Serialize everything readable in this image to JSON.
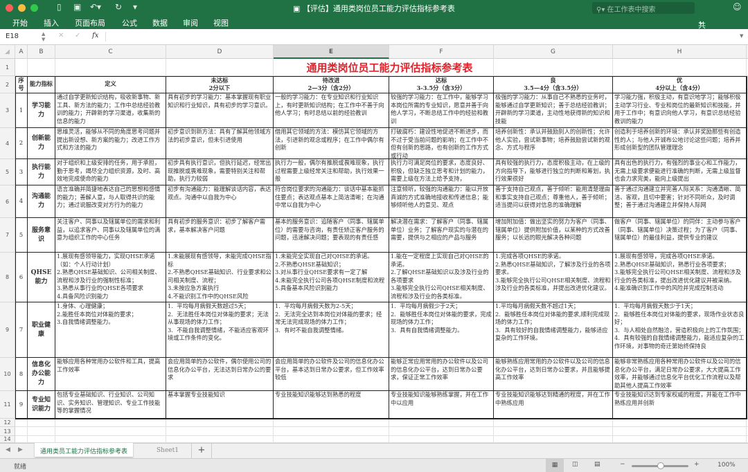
{
  "window": {
    "title": "【评估】通用类岗位员工能力评估指标参考表",
    "search_placeholder": "在工作表中搜索"
  },
  "ribbon": {
    "tabs": [
      "开始",
      "插入",
      "页面布局",
      "公式",
      "数据",
      "审阅",
      "视图"
    ],
    "share": "共享"
  },
  "formula_bar": {
    "cell_ref": "E18",
    "fx": "fx",
    "value": ""
  },
  "columns": [
    "A",
    "B",
    "C",
    "D",
    "E",
    "F",
    "G",
    "H"
  ],
  "row_numbers": [
    "1",
    "2",
    "3",
    "4",
    "5",
    "6",
    "7",
    "8",
    "9",
    "10",
    "11",
    "12",
    "13",
    "14"
  ],
  "sheet": {
    "title": "通用类岗位员工能力评估指标参考表",
    "headers": {
      "no": "序号",
      "name": "能力指标",
      "def": "定义",
      "levels": [
        {
          "label": "未达标",
          "range": "2分以下"
        },
        {
          "label": "待改进",
          "range": "2—3分（含2分）"
        },
        {
          "label": "达标",
          "range": "3-3.5分（含3分）"
        },
        {
          "label": "良",
          "range": "3.5—4分（含3.5分）"
        },
        {
          "label": "优",
          "range": "4分以上（含4分）"
        }
      ]
    },
    "rows": [
      {
        "no": "1",
        "name": "学习能力",
        "def": "通过自学更新知识结构，吸收新事物、新工具、新方法的能力；工作中总结经验教训的能力；开辟新的学习渠道，收集新的信息的能力",
        "levels": [
          "具有初步的学习能力：基本掌握现有职业知识和行业知识，具有初步的学习意识。",
          "一般的学习能力：在专业知识和行业知识上，有时更新知识结构；在工作中不善于向他人学习；有时总结以前的经验教训",
          "较强的学习能力：在工作中，能够学习本岗位所需的专业知识，愿意并善于向他人学习，不断总结工作中的经验和教训",
          "极强的学习能力：从事自己不熟悉的业务时，能够通过自学更新知识；善于总结经验教训；开辟新的学习渠道，主动性地获得新的知识和技能",
          "学习能力强，积极主动，有意识地学习；能够积极主动学习行业、专业和岗位的最新知识和技能，并用于工作中；有意识向他人学习，有意识总结经验教训的能力"
        ]
      },
      {
        "no": "2",
        "name": "创新能力",
        "def": "思维灵活，能够从不同的角度思考问题并提出新设想、新方案的能力；改进工作方式和方法的能力",
        "levels": [
          "初步意识到新方法：具有了解其他领域方法的初步意识，但未引进使用",
          "借用其它领域的方法：模仿其它领域的方法，引进新的观念或程序；在工作中偶尔有创新",
          "打破腐朽：建设性地促进不断进步，而不过于受当前问题的影响；在工作中不但有创新的思路，也有创新的工作方式或行动",
          "培养创新性：承认并鼓励别人的创新性；允许他人实验，尝试新事物；培养鼓励尝试新的观念、方式与程序",
          "创造利于培养创新的环境：承认并奖励那些有创造性的人；与他人开诚布公地讨论这些问题；培养并形成创新型的团队管理理念"
        ]
      },
      {
        "no": "3",
        "name": "执行能力",
        "def": "对于组织和上级安排的任务，用于承担，勤于思考，竭尽全力组织资源，及时、高效地完成使命的能力",
        "levels": [
          "初步具有执行意识，但执行延迟，经常出现推脱或畏难现象，需要特别关注和帮助，执行力较弱",
          "执行力一般，偶尔有推脱或畏难现象，执行过程需要上级经常关注和帮助，执行效果一般",
          "执行力可满足岗位的要求，态度良好、积极，但缺乏独立思考和计划的能力，需要上级在方法上给予支持，",
          "具有较强的执行力，态度积极主动，在上级的方向指导下，能够进行独立的判断和筹划，执行效果很好",
          "具有出色的执行力，有强烈的事业心和工作能力，无需上级要求便能进行准确的判断，无需上级监督也会力求完美，能向上级提出"
        ]
      },
      {
        "no": "4",
        "name": "沟通能力",
        "def": "语言准确并简捷地表达自己的思想和感情的能力；善解人意，与人取得共识的能力；通过说服改变对方行为的能力",
        "levels": [
          "初步有沟通能力：能理解谈话内容，表达观点。沟通中以自我为中心",
          "符合岗位要求的沟通能力：谈话中基本能抓住要点；表达观点基本上简洁清晰；在沟通中常以自我为中心",
          "注意倾听，较强的沟通能力：能以开放真诚的方式准确地接收和传递信息；能够倾听他人的意见、观点",
          "善于支持自己观点，善于倾听：能用清楚理由和事实支持自己观点；尊重他人，善于倾听；适当提问以获得对信息的准确理解",
          "善于通过沟通建立并完善人际关系：沟通清晰、简洁、客观，且切中要害；针对不同听众，及时调整；善于通过沟通建立并保持人际网"
        ]
      },
      {
        "no": "5",
        "name": "服务意识",
        "def": "关注客户、同事以及辖属单位的需求和利益，以追求客户、同事以及辖属单位的满意为组织工作的中心任务",
        "levels": [
          "具有初步的服务意识：初步了解客户需求，基本解决客户问题",
          "基本的服务意识：追随客户（同事、辖属单位）的需要与咨询，有责任矫正客户服务的问题，迅速解决问题；要表现的有责任感",
          "解决潜在需求：了解客户（同事、辖属单位）业务；了解客户现实的与潜在的需要，提供与之相应的产品与服务",
          "增加附加值：做出坚实的努力为客户（同事、辖属单位）提供附加价值，以某种的方式改善服务；以长远的眼光解决各种问题",
          "做客户（同事、辖属单位）的同伴：主动参与客户（同事、辖属单位）决策过程；为了客户（同事、辖属单位）的最佳利益，提供专业的建议"
        ]
      },
      {
        "no": "6",
        "name": "QHSE能力",
        "def": "1.展现有感领导能力，实现QHSE承诺（如：个人行动计划）\n2.熟悉QHSE基础知识、公司相关制度、流程和涉及行业的强制性标准；\n3.熟悉从事行业的QHSE各项要求\n4.具备风险识别能力",
        "levels": [
          "1.未能展现有感领导，未能完成QHSE指标\n2.不熟悉QHSE基础知识、行业要求和公司相关制度、流程；\n3.未按应急方案执行\n4.不能识别工作中的QHSE风险",
          "1.未能完全实现自己对QHSE的承诺。\n2.不熟悉QHSE基础知识；\n3.对从事行业QHSE要求有一定了解\n4.未能完全执行公司各项QHSE制度和流程\n5.具备基本风险识别能力",
          "1.能在一定程度上实现自己对QHSE的承诺。\n2.了解QHSE基础知识以及涉及行业的各项要求\n3.能够完全执行公司QHSE相关制度、流程和涉及行业的各类标准。",
          "1.完成各项QHSE的承诺。\n2.熟悉QHSE基础知识，了解涉及行业的各项要求。\n3.能够完全执行公司QHSE相关制度、流程和涉及行业的各类标准，并提出改进优化建议。",
          "1.展现有感领导，完成各项QHSE承诺。\n2.熟悉QHSE基础知识，熟悉行业各项要求；\n3.能够完全执行公司QHSE相关制度、流程和涉及行业的各类标准，提出改进优化建议并被采纳。\n4.能准确识别工作中的风险并完成控制活动"
        ]
      },
      {
        "no": "7",
        "name": "职业健康",
        "def": "1.身体、心理健康；\n2.能胜任本岗位对体能的要求；\n3.自我情绪调整能力。",
        "levels": [
          "1.  平均每月病假天数超过5天；\n2.  无法胜任本岗位对体能的要求；无法从事现场的体力工作；\n3.  不能自我调整情绪，不能适应客观环境或工作条件的变化。",
          "1.  平均每月病假天数为2-5天；\n2.  无法完全达到本岗位对体能的要求；经常无法完成现场的体力工作；\n3.  有时不能自我调整情绪。",
          "1.  平均每月病假少于2天；\n2.  能够胜任本岗位对体能的要求，完成现场的体力工作；\n3.  具有自我情绪调整能力。",
          "1.平均每月病假天数不超过1天；\n2.  能够胜任本岗位对体能的要求,顺利完成现场的体力工作；\n3.  具有较好的自我情绪调整能力，能够适应复杂的工作环境。",
          "1.  平均每月病假天数少于1天；\n2.  能够胜任本岗位对体能的要求，现场作业状态良好；\n3.  与人相处自然融洽，营造积极向上的工作氛围；\n4.  具有较强的自我情绪调整能力，能适应复杂的工作环境，对事物的奇迁第始终保持良"
        ]
      },
      {
        "no": "8",
        "name": "信息化办公能力",
        "def": "能够应用各种常用办公软件和工具，提高工作效率",
        "levels": [
          "会应用简单的办公软件，偶尔使用公司的信息化办公平台，无法达到日常办公的要求",
          "会应用简单的办公软件及公司的信息化办公平台，基本达到日常办公要求，但工作效率较低",
          "能够正常应用常用的办公软件以及公司的信息化办公平台，达到日常办公要求，保证正常工作效率",
          "能够熟练应用常用的办公软件以及公司的信息化办公平台，达到日常办公要求，并且能够提高工作效率",
          "能够非常熟练应用各种常用办公软件以及公司的信息化办公平台，满足日常办公要求，大大提高工作效率，并能够通过信息化平台优化工作流程以及帮助其他人提高工作效率"
        ]
      },
      {
        "no": "9",
        "name": "专业知识能力",
        "def": "包括专业基础知识、行业知识、公司知识、实务知识、管理知识、专业工作技能等的掌握情况",
        "levels": [
          "基本掌握专业技能知识",
          "专业技能知识能够达到熟悉的程度",
          "专业技能知识能够熟练掌握，并在工作中以应用",
          "专业技能知识能够达到精通的程度，并在工作中熟练应用",
          "专业技能知识达到专家权威的程度，并能在工作中熟练应用并创新"
        ]
      }
    ]
  },
  "sheet_tabs": [
    "通用类员工能力评估指标参考表",
    "Sheet1"
  ],
  "status": {
    "text": "就绪",
    "zoom": "100%"
  },
  "colors": {
    "brand": "#207245",
    "title": "#e0232b"
  }
}
